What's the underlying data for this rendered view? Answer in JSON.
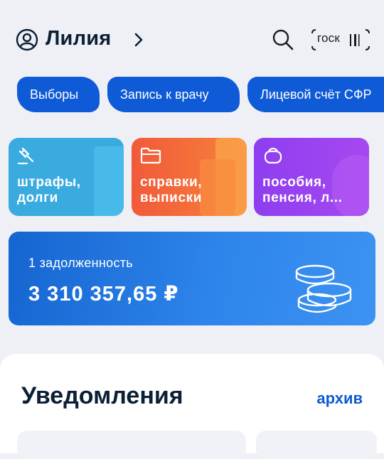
{
  "header": {
    "profile_name": "Лилия",
    "gosk_label": "госк"
  },
  "chips": [
    {
      "label": "Выборы"
    },
    {
      "label": "Запись к врачу"
    },
    {
      "label": "Лицевой счёт СФР"
    }
  ],
  "tiles": [
    {
      "label": "штрафы,\nдолги",
      "icon": "gavel-icon",
      "color": "#3aabdf"
    },
    {
      "label": "справки,\nвыписки",
      "icon": "folder-icon",
      "color": "#f26b3a"
    },
    {
      "label": "пособия,\nпенсия, л...",
      "icon": "wallet-icon",
      "color": "#9b3ff0"
    }
  ],
  "debt": {
    "caption": "1 задолженность",
    "amount": "3 310 357,65 ₽"
  },
  "notifications": {
    "title": "Уведомления",
    "archive_label": "архив"
  },
  "colors": {
    "primary": "#0f5ad6",
    "background": "#eef0f6"
  }
}
